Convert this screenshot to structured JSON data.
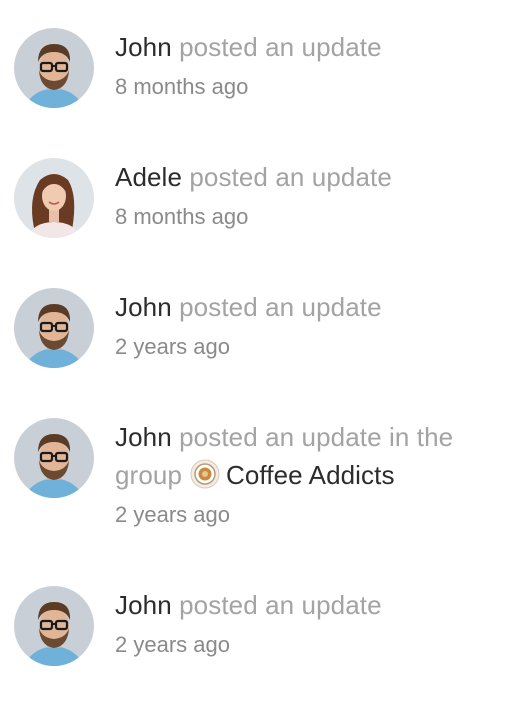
{
  "activity": [
    {
      "user": "John",
      "action": "posted an update",
      "time": "8 months ago",
      "avatar": "man-glasses-avatar"
    },
    {
      "user": "Adele",
      "action": "posted an update",
      "time": "8 months ago",
      "avatar": "woman-avatar"
    },
    {
      "user": "John",
      "action": "posted an update",
      "time": "2 years ago",
      "avatar": "man-glasses-avatar"
    },
    {
      "user": "John",
      "action": "posted an update in the group",
      "group": "Coffee Addicts",
      "group_icon": "coffee-cup-icon",
      "time": "2 years ago",
      "avatar": "man-glasses-avatar"
    },
    {
      "user": "John",
      "action": "posted an update",
      "time": "2 years ago",
      "avatar": "man-glasses-avatar"
    }
  ],
  "colors": {
    "name": "#2c2c2c",
    "action": "#a3a3a3",
    "time": "#8a8a8a",
    "avatar_bg_man": "#c9cfd6",
    "avatar_bg_woman": "#dde3e6"
  }
}
